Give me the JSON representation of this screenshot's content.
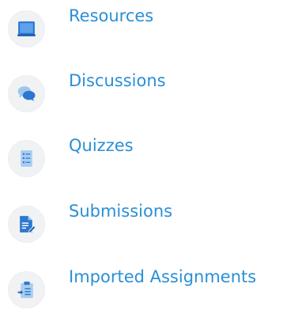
{
  "nav": {
    "items": [
      {
        "label": "Resources",
        "icon": "resources-icon"
      },
      {
        "label": "Discussions",
        "icon": "discussions-icon"
      },
      {
        "label": "Quizzes",
        "icon": "quizzes-icon"
      },
      {
        "label": "Submissions",
        "icon": "submissions-icon"
      },
      {
        "label": "Imported Assignments",
        "icon": "imported-assignments-icon"
      }
    ]
  },
  "colors": {
    "link": "#2a8fd6",
    "icon_primary": "#2c77d0",
    "icon_circle": "#f0f2f4"
  }
}
